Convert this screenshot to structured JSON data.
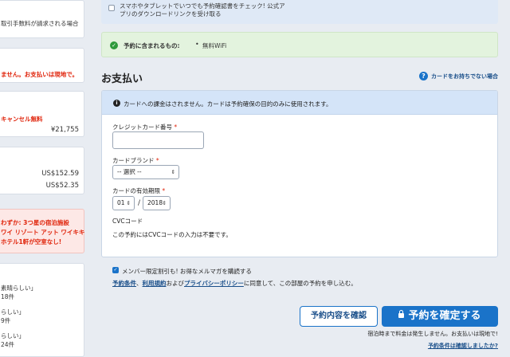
{
  "sidebar": {
    "card1": [
      "取引手数料が請求される場合"
    ],
    "card2": [
      "ません。お支払いは現地で。"
    ],
    "card3": {
      "cancel": "キャンセル無料",
      "price": "¥21,755"
    },
    "card4": {
      "price1": "US$152.59",
      "price2": "US$52.35"
    },
    "alert": [
      "わずか: 3つ星の宿泊施設",
      "ワイ リゾート アット ワイキキ",
      "ホテル1軒が空室なし!"
    ],
    "reviews": [
      "素晴らしい」",
      "18件",
      "らしい」",
      "9件",
      "らしい」",
      "24件"
    ]
  },
  "top_notice": {
    "line1": "スマホやタブレットでいつでも予約確認書をチェック! 公式ア",
    "line2": "プリのダウンロードリンクを受け取る"
  },
  "included": {
    "label": "予約に含まれるもの:",
    "bullet": "•",
    "item": "無料WiFi"
  },
  "payment": {
    "title": "お支払い",
    "help_link": "カードをお持ちでない場合",
    "notice": "カードへの課金はされません。カードは予約確保の目的のみに使用されます。",
    "card_number_label": "クレジットカード番号",
    "card_number_value": "",
    "brand_label": "カードブランド",
    "brand_value": "-- 選択 --",
    "expiry_label": "カードの有効期限",
    "expiry_month": "01",
    "expiry_year": "2018",
    "expiry_sep": "/",
    "cvc_label": "CVCコード",
    "cvc_note": "この予約にはCVCコードの入力は不要です。",
    "required_mark": "*"
  },
  "consent": {
    "member_text": "メンバー限定割引も! お得なメルマガを購読する",
    "terms_link": "予約条件",
    "sep1": "、",
    "rules_link": "利用規約",
    "and": "および",
    "privacy_link": "プライバシーポリシー",
    "terms_rest": "に同意して、この部屋の予約を申し込む。"
  },
  "actions": {
    "confirm_button": "予約内容を確認",
    "book_button": "予約を確定する",
    "pay_note": "宿泊時まで料金は発生しません。お支払いは現地で!",
    "check_terms": "予約条件は確認しましたか?"
  },
  "colors": {
    "primary": "#1a73c9",
    "success": "#2e9a3b",
    "required": "#e0240b"
  }
}
